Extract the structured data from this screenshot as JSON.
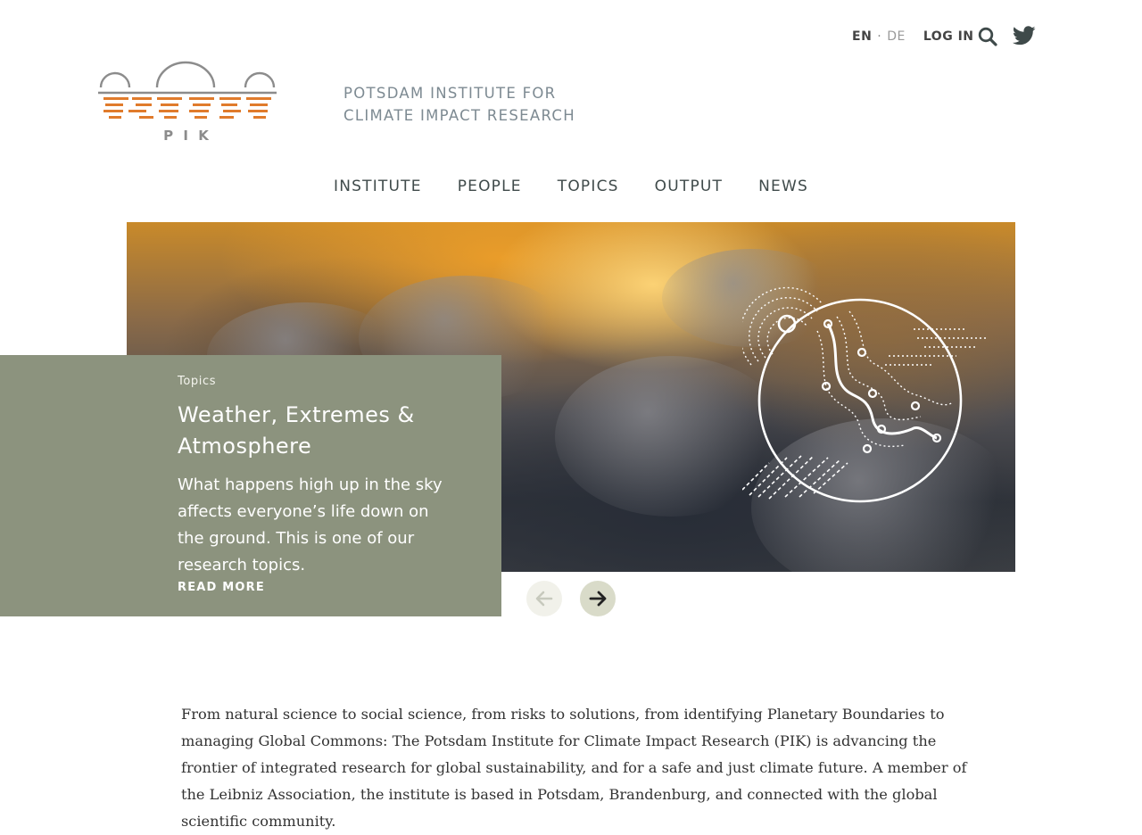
{
  "utility": {
    "lang_en": "EN",
    "lang_sep": "·",
    "lang_de": "DE",
    "login": "LOG IN",
    "search_icon": "search-icon",
    "twitter_icon": "twitter-icon"
  },
  "logo": {
    "text": "P I K",
    "colors": {
      "orange": "#e07b2c",
      "grey": "#8c8c8c"
    }
  },
  "site": {
    "line1": "POTSDAM INSTITUTE FOR",
    "line2": "CLIMATE IMPACT RESEARCH"
  },
  "nav": {
    "items": [
      {
        "label": "INSTITUTE"
      },
      {
        "label": "PEOPLE"
      },
      {
        "label": "TOPICS"
      },
      {
        "label": "OUTPUT"
      },
      {
        "label": "NEWS"
      }
    ]
  },
  "hero": {
    "category": "Topics",
    "title": "Weather, Extremes & Atmosphere",
    "text": "What happens high up in the sky affects everyone’s life down on the ground. This is one of our research topics.",
    "read_more": "READ MORE",
    "card_color": "#8c937e",
    "prev_icon": "arrow-left-icon",
    "next_icon": "arrow-right-icon"
  },
  "intro": {
    "text": "From natural science to social science, from risks to solutions, from identifying Planetary Boundaries to managing Global Commons: The Potsdam Institute for Climate Impact Research (PIK) is advancing the frontier of integrated research for global sustainability, and for a safe and just climate future. A member of the Leibniz Association, the institute is based in Potsdam, Brandenburg, and connected with the global scientific community."
  }
}
